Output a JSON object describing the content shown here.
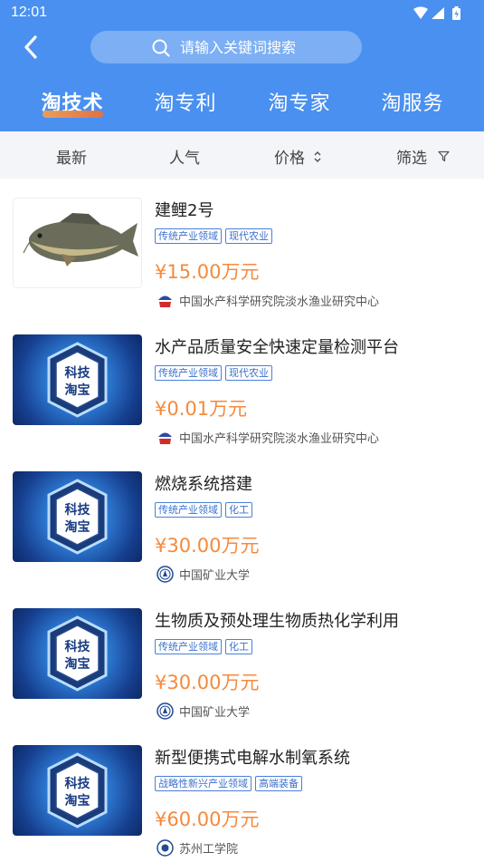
{
  "status_bar": {
    "time": "12:01"
  },
  "header": {
    "search": {
      "placeholder": "请输入关键词搜索"
    },
    "tabs": [
      {
        "label": "淘技术",
        "active": true
      },
      {
        "label": "淘专利",
        "active": false
      },
      {
        "label": "淘专家",
        "active": false
      },
      {
        "label": "淘服务",
        "active": false
      }
    ]
  },
  "sort_bar": {
    "latest": "最新",
    "popularity": "人气",
    "price": "价格",
    "filter": "筛选"
  },
  "items": [
    {
      "image": "carp-photo",
      "title": "建鲤2号",
      "tags": [
        "传统产业领域",
        "现代农业"
      ],
      "price": "¥15.00万元",
      "org": "中国水产科学研究院淡水渔业研究中心",
      "org_logo": "ffrc-logo-icon"
    },
    {
      "image": "kejitaobao-badge",
      "badge_line1": "科技",
      "badge_line2": "淘宝",
      "title": "水产品质量安全快速定量检测平台",
      "tags": [
        "传统产业领域",
        "现代农业"
      ],
      "price": "¥0.01万元",
      "org": "中国水产科学研究院淡水渔业研究中心",
      "org_logo": "ffrc-logo-icon"
    },
    {
      "image": "kejitaobao-badge",
      "badge_line1": "科技",
      "badge_line2": "淘宝",
      "title": "燃烧系统搭建",
      "tags": [
        "传统产业领域",
        "化工"
      ],
      "price": "¥30.00万元",
      "org": "中国矿业大学",
      "org_logo": "cumt-logo-icon"
    },
    {
      "image": "kejitaobao-badge",
      "badge_line1": "科技",
      "badge_line2": "淘宝",
      "title": "生物质及预处理生物质热化学利用",
      "tags": [
        "传统产业领域",
        "化工"
      ],
      "price": "¥30.00万元",
      "org": "中国矿业大学",
      "org_logo": "cumt-logo-icon"
    },
    {
      "image": "kejitaobao-badge",
      "badge_line1": "科技",
      "badge_line2": "淘宝",
      "title": "新型便携式电解水制氧系统",
      "tags": [
        "战略性新兴产业领域",
        "高端装备"
      ],
      "price": "¥60.00万元",
      "org": "苏州工学院",
      "org_logo": "szit-logo-icon"
    }
  ],
  "colors": {
    "header_bg": "#4a90f0",
    "price": "#f58a3c",
    "tag_border": "#4a80d8",
    "tab_underline": "#f36d2f"
  }
}
